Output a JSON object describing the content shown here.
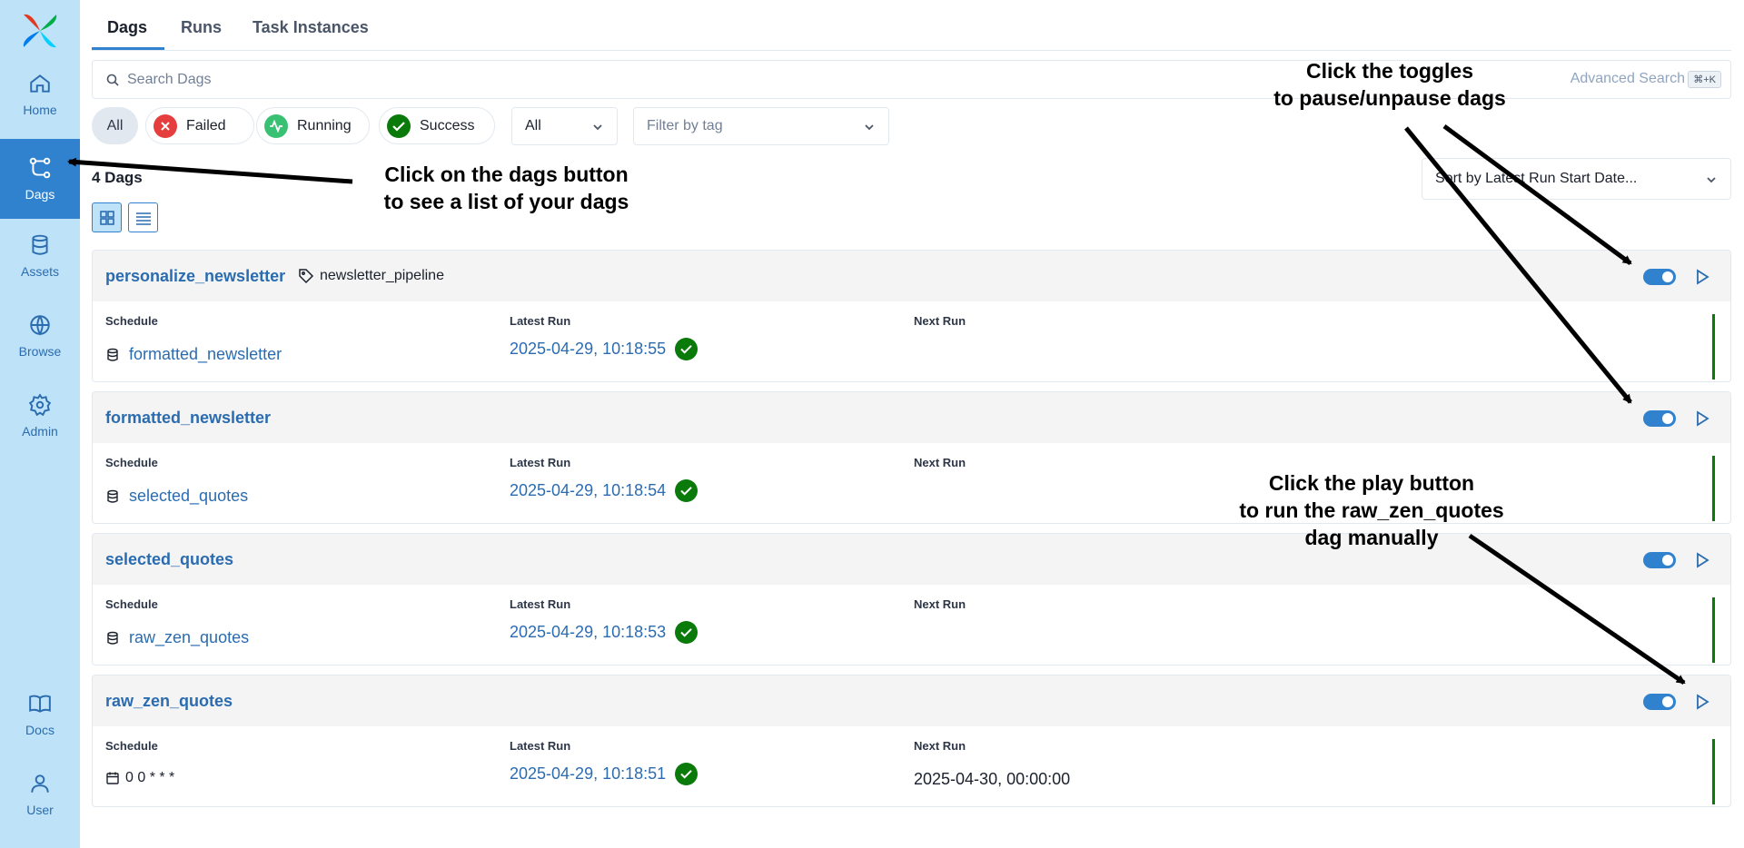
{
  "sidebar": {
    "items": [
      {
        "label": "Home"
      },
      {
        "label": "Dags"
      },
      {
        "label": "Assets"
      },
      {
        "label": "Browse"
      },
      {
        "label": "Admin"
      },
      {
        "label": "Docs"
      },
      {
        "label": "User"
      }
    ],
    "active": "Dags"
  },
  "tabs": [
    {
      "label": "Dags"
    },
    {
      "label": "Runs"
    },
    {
      "label": "Task Instances"
    }
  ],
  "search": {
    "placeholder": "Search Dags",
    "advanced": "Advanced Search",
    "shortcut": "⌘+K"
  },
  "filters": {
    "chips": [
      {
        "label": "All"
      },
      {
        "label": "Failed"
      },
      {
        "label": "Running"
      },
      {
        "label": "Success"
      }
    ],
    "state_select": "All",
    "tag_select_placeholder": "Filter by tag"
  },
  "count_text": "4 Dags",
  "sort": "Sort by Latest Run Start Date...",
  "columns": {
    "schedule": "Schedule",
    "latest_run": "Latest Run",
    "next_run": "Next Run"
  },
  "dags": [
    {
      "name": "personalize_newsletter",
      "tag": "newsletter_pipeline",
      "schedule": "formatted_newsletter",
      "latest_run": "2025-04-29, 10:18:55",
      "next_run": ""
    },
    {
      "name": "formatted_newsletter",
      "tag": "",
      "schedule": "selected_quotes",
      "latest_run": "2025-04-29, 10:18:54",
      "next_run": ""
    },
    {
      "name": "selected_quotes",
      "tag": "",
      "schedule": "raw_zen_quotes",
      "latest_run": "2025-04-29, 10:18:53",
      "next_run": ""
    },
    {
      "name": "raw_zen_quotes",
      "tag": "",
      "schedule": "0 0 * * *",
      "latest_run": "2025-04-29, 10:18:51",
      "next_run": "2025-04-30, 00:00:00"
    }
  ],
  "annotations": {
    "dags_button": [
      "Click on the dags button",
      "to see a list of your dags"
    ],
    "toggles": [
      "Click the toggles",
      "to pause/unpause dags"
    ],
    "play": [
      "Click the play button",
      "to run the raw_zen_quotes",
      "dag manually"
    ]
  },
  "colors": {
    "sidebar_bg": "#bee3f8",
    "active_nav": "#3182ce",
    "link": "#2b6cb0",
    "success": "#0a7a0a",
    "failed": "#e53e3e",
    "running": "#38c172"
  }
}
